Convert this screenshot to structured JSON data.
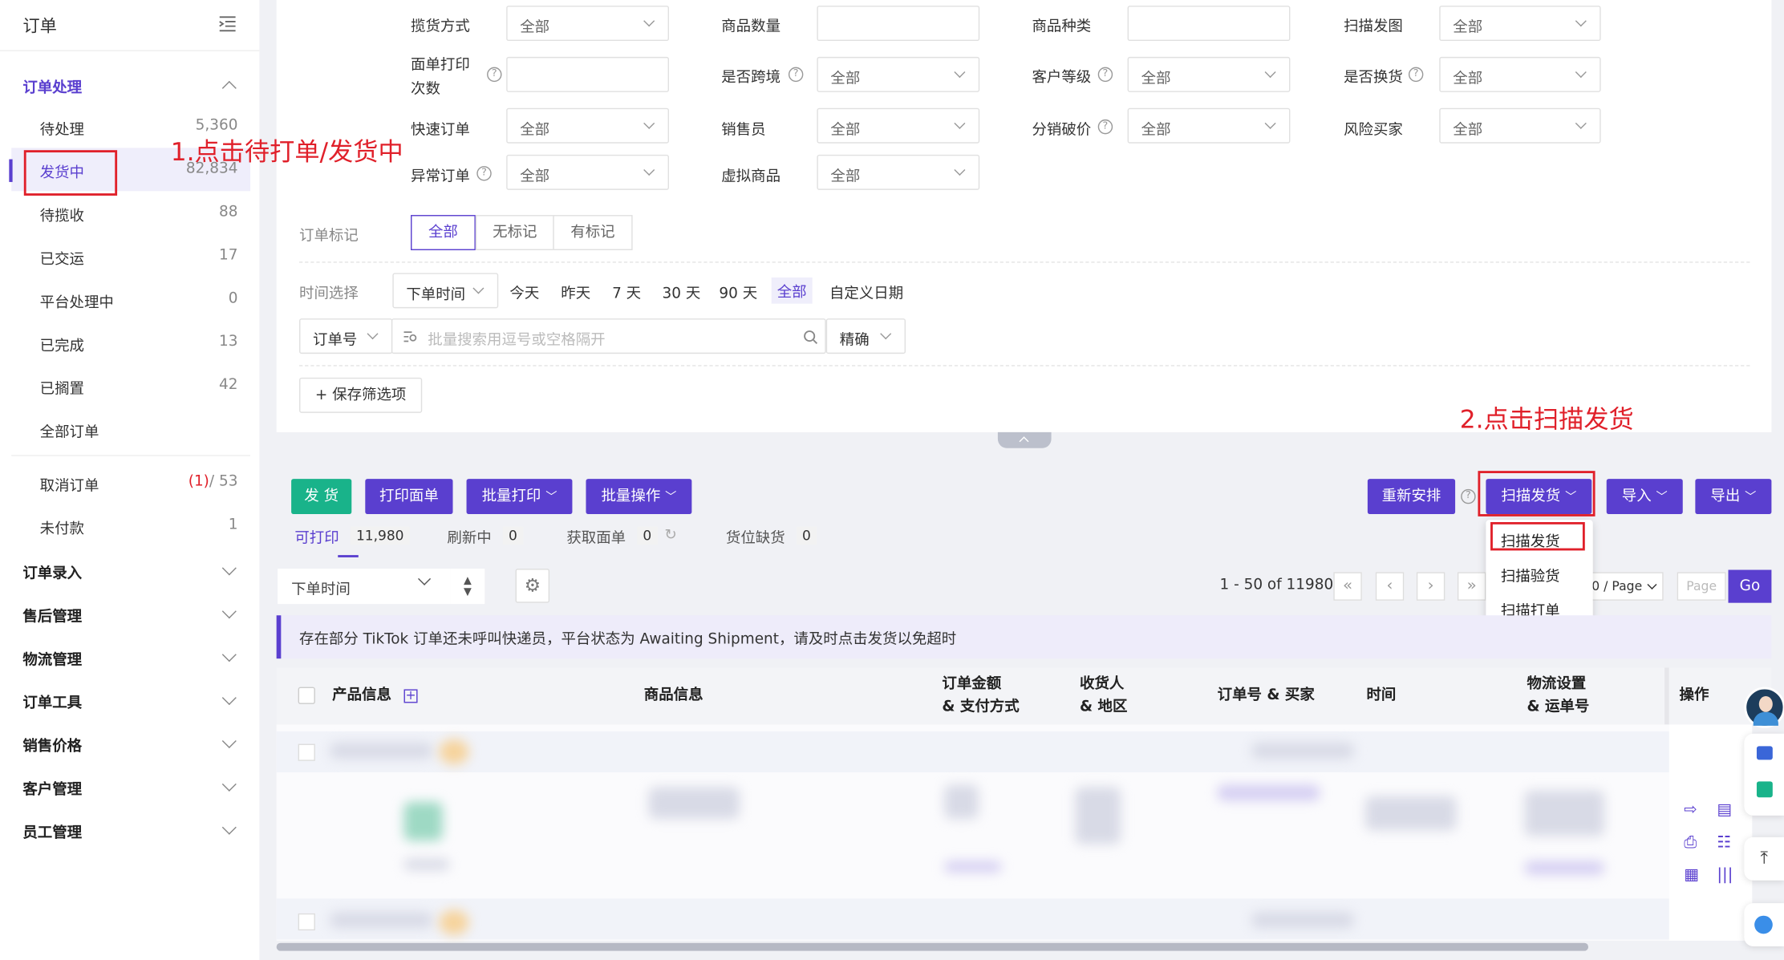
{
  "sidebar": {
    "title": "订单",
    "group1": "订单处理",
    "items": [
      {
        "label": "待处理",
        "count": "5,360"
      },
      {
        "label": "发货中",
        "count": "82,834"
      },
      {
        "label": "待揽收",
        "count": "88"
      },
      {
        "label": "已交运",
        "count": "17"
      },
      {
        "label": "平台处理中",
        "count": "0"
      },
      {
        "label": "已完成",
        "count": "13"
      },
      {
        "label": "已搁置",
        "count": "42"
      },
      {
        "label": "全部订单",
        "count": ""
      },
      {
        "label": "取消订单",
        "count_red": "(1)",
        "count": "/ 53"
      },
      {
        "label": "未付款",
        "count": "1"
      }
    ],
    "groups": [
      "订单录入",
      "售后管理",
      "物流管理",
      "订单工具",
      "销售价格",
      "客户管理",
      "员工管理"
    ]
  },
  "filters": {
    "all": "全部",
    "pickup_method": "揽货方式",
    "product_qty": "商品数量",
    "product_types": "商品种类",
    "scan_image": "扫描发图",
    "print_count_1": "面单打印",
    "print_count_2": "次数",
    "cross_border": "是否跨境",
    "customer_level": "客户等级",
    "exchange": "是否换货",
    "express_order": "快速订单",
    "salesperson": "销售员",
    "distribution_price": "分销破价",
    "risk_buyer": "风险买家",
    "abnormal_order": "异常订单",
    "virtual_goods": "虚拟商品",
    "order_mark": "订单标记",
    "mark_all": "全部",
    "mark_none": "无标记",
    "mark_has": "有标记",
    "time_select": "时间选择",
    "time_type": "下单时间",
    "today": "今天",
    "yesterday": "昨天",
    "d7": "7 天",
    "d30": "30 天",
    "d90": "90 天",
    "time_all": "全部",
    "custom_date": "自定义日期",
    "search_type": "订单号",
    "search_placeholder": "批量搜索用逗号或空格隔开",
    "match": "精确",
    "save_filter": "保存筛选项"
  },
  "toolbar": {
    "ship": "发 货",
    "print_label": "打印面单",
    "batch_print": "批量打印",
    "batch_ops": "批量操作",
    "rearrange": "重新安排",
    "scan_ship": "扫描发货",
    "import": "导入",
    "export": "导出"
  },
  "dropdown": [
    "扫描发货",
    "扫描验货",
    "扫描打单"
  ],
  "tabs": [
    {
      "label": "可打印",
      "count": "11,980"
    },
    {
      "label": "刷新中",
      "count": "0"
    },
    {
      "label": "获取面单",
      "count": "0"
    },
    {
      "label": "货位缺货",
      "count": "0"
    }
  ],
  "sort": {
    "field": "下单时间"
  },
  "pagination": {
    "range": "1 - 50 of 11980",
    "per_page": "0 / Page",
    "page_placeholder": "Page",
    "go": "Go"
  },
  "notice": "存在部分 TikTok 订单还未呼叫快递员，平台状态为 Awaiting Shipment，请及时点击发货以免超时",
  "table": {
    "headers": [
      "产品信息",
      "商品信息",
      "订单金额",
      "& 支付方式",
      "收货人",
      "& 地区",
      "订单号 & 买家",
      "时间",
      "物流设置",
      "& 运单号",
      "操作"
    ]
  },
  "annotations": {
    "step1": "1.点击待打单/发货中",
    "step2": "2.点击扫描发货"
  },
  "colors": {
    "accent": "#5a3fcf",
    "green": "#19b38a",
    "red": "#e0202a"
  }
}
